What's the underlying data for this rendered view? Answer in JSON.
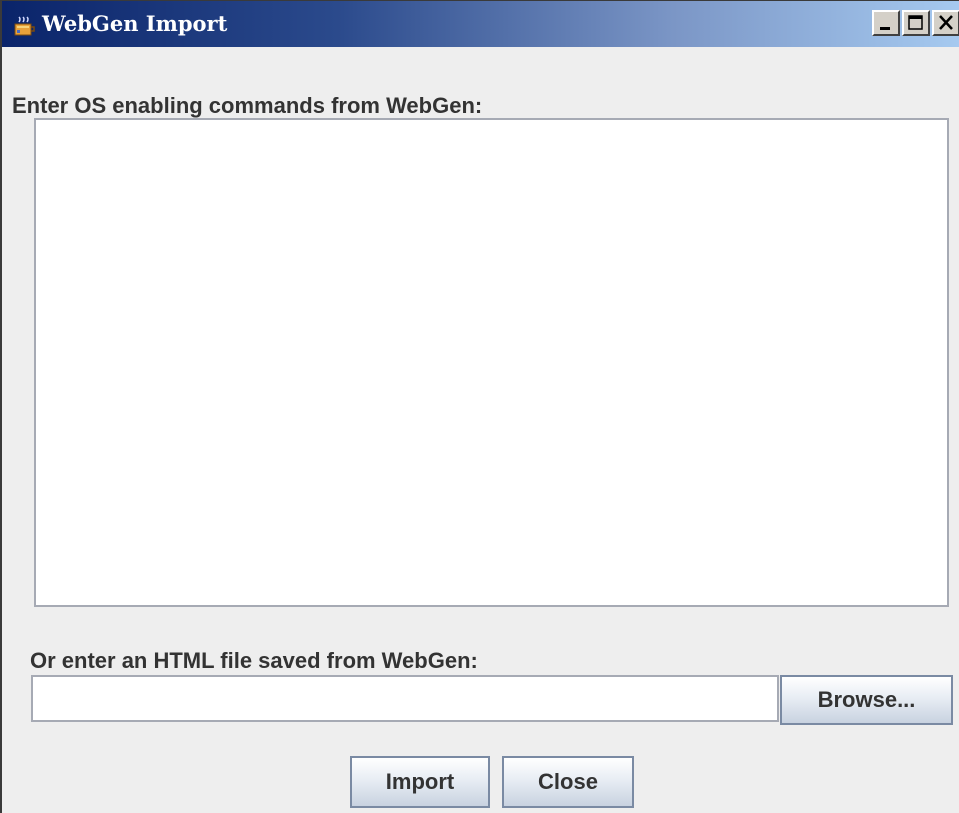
{
  "window": {
    "title": "WebGen Import",
    "icon": "java-cup-icon",
    "controls": {
      "minimize": "minimize-icon",
      "maximize": "maximize-icon",
      "close": "close-icon"
    }
  },
  "commands": {
    "label": "Enter OS enabling commands from WebGen:",
    "value": ""
  },
  "html_file": {
    "label": "Or enter an HTML file saved from WebGen:",
    "value": "",
    "browse_label": "Browse..."
  },
  "actions": {
    "import_label": "Import",
    "close_label": "Close"
  },
  "colors": {
    "titlebar_start": "#0a246a",
    "titlebar_end": "#a6caf0",
    "dialog_background": "#eeeeee",
    "field_border": "#a6aab4",
    "button_border": "#7a8aa3"
  }
}
